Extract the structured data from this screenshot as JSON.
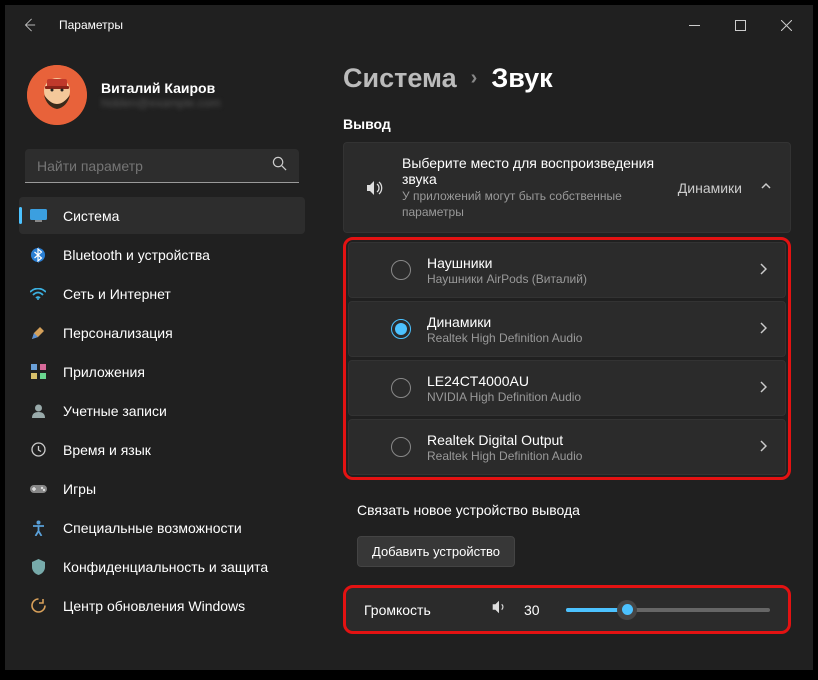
{
  "window": {
    "title": "Параметры"
  },
  "user": {
    "name": "Виталий Каиров",
    "email": "hidden@example.com"
  },
  "search": {
    "placeholder": "Найти параметр"
  },
  "nav": {
    "items": [
      {
        "icon": "system",
        "label": "Система",
        "active": true
      },
      {
        "icon": "bluetooth",
        "label": "Bluetooth и устройства"
      },
      {
        "icon": "network",
        "label": "Сеть и Интернет"
      },
      {
        "icon": "personalize",
        "label": "Персонализация"
      },
      {
        "icon": "apps",
        "label": "Приложения"
      },
      {
        "icon": "accounts",
        "label": "Учетные записи"
      },
      {
        "icon": "time",
        "label": "Время и язык"
      },
      {
        "icon": "gaming",
        "label": "Игры"
      },
      {
        "icon": "access",
        "label": "Специальные возможности"
      },
      {
        "icon": "privacy",
        "label": "Конфиденциальность и защита"
      },
      {
        "icon": "update",
        "label": "Центр обновления Windows"
      }
    ]
  },
  "breadcrumb": {
    "parent": "Система",
    "current": "Звук"
  },
  "output": {
    "section_label": "Вывод",
    "header": {
      "title": "Выберите место для воспроизведения звука",
      "subtitle": "У приложений могут быть собственные параметры",
      "right_label": "Динамики"
    },
    "devices": [
      {
        "name": "Наушники",
        "sub": "Наушники AirPods (Виталий)",
        "selected": false
      },
      {
        "name": "Динамики",
        "sub": "Realtek High Definition Audio",
        "selected": true
      },
      {
        "name": "LE24CT4000AU",
        "sub": "NVIDIA High Definition Audio",
        "selected": false
      },
      {
        "name": "Realtek Digital Output",
        "sub": "Realtek High Definition Audio",
        "selected": false
      }
    ],
    "pair_label": "Связать новое устройство вывода",
    "add_button": "Добавить устройство"
  },
  "volume": {
    "label": "Громкость",
    "value": 30
  }
}
